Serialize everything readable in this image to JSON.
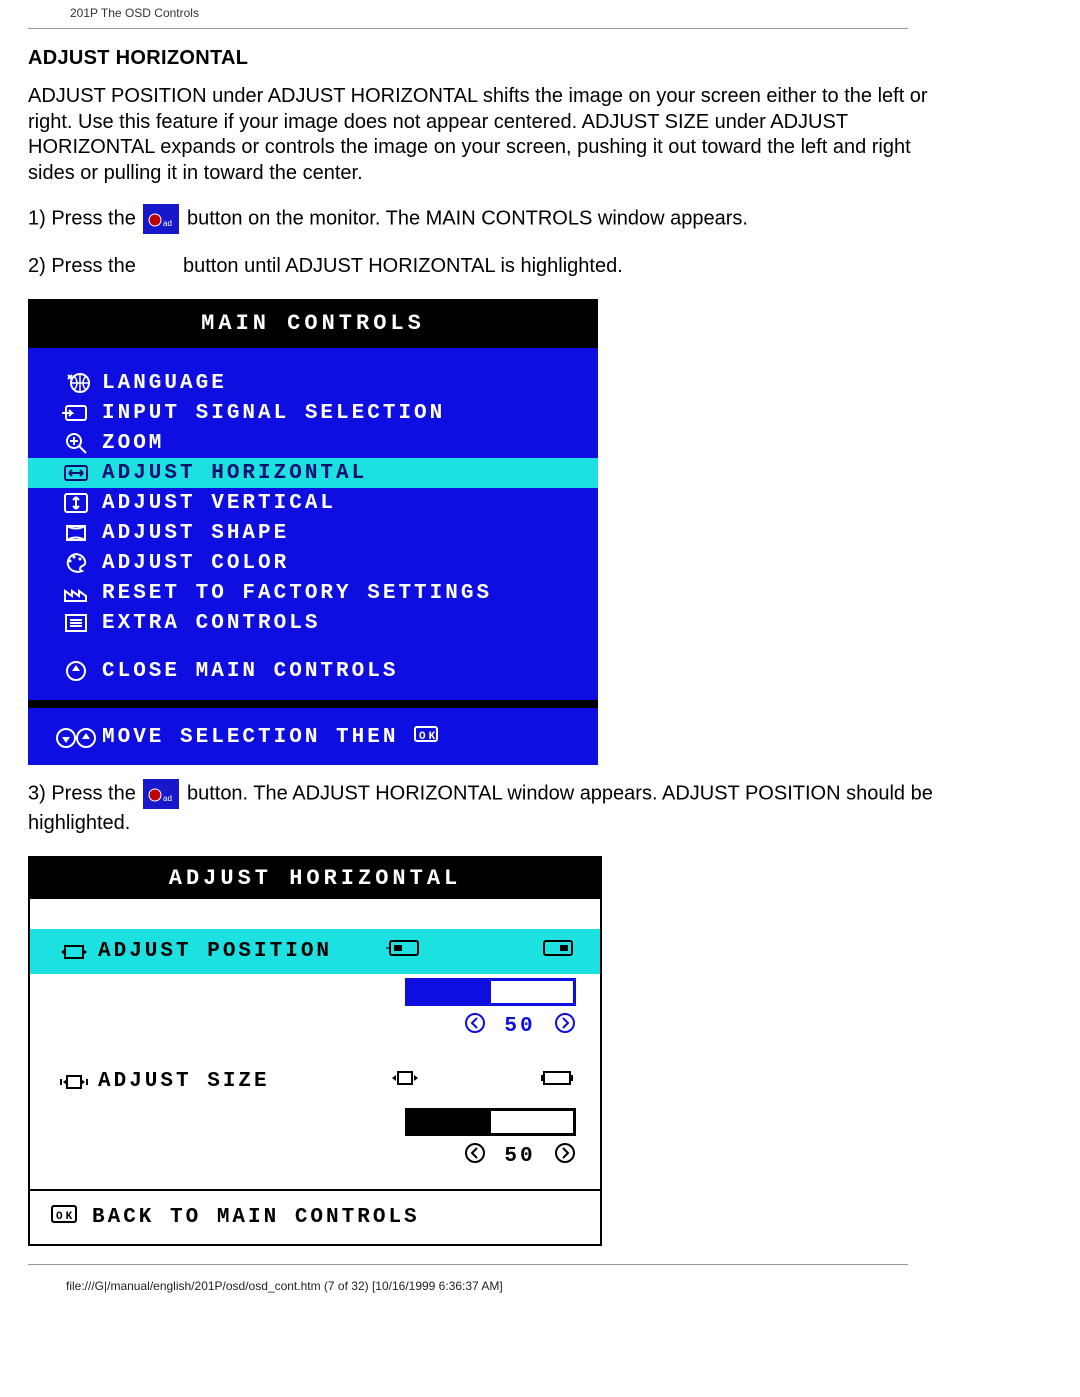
{
  "header": "201P The OSD Controls",
  "section_title": "ADJUST HORIZONTAL",
  "intro": "ADJUST POSITION under ADJUST HORIZONTAL shifts the image on your screen either to the left or right. Use this feature if your image does not appear centered. ADJUST SIZE under ADJUST HORIZONTAL expands or controls the image on your screen, pushing it out toward the left and right sides or pulling it in toward the center.",
  "step1_a": "1) Press the ",
  "step1_b": "button on the monitor. The MAIN CONTROLS window appears.",
  "step2_a": "2) Press the ",
  "step2_b": "button until ADJUST HORIZONTAL is highlighted.",
  "step3_a": "3) Press the ",
  "step3_b": "button. The ADJUST HORIZONTAL window appears. ADJUST POSITION should be highlighted.",
  "osd1": {
    "title": "MAIN CONTROLS",
    "items": [
      "LANGUAGE",
      "INPUT SIGNAL SELECTION",
      "ZOOM",
      "ADJUST HORIZONTAL",
      "ADJUST VERTICAL",
      "ADJUST SHAPE",
      "ADJUST COLOR",
      "RESET TO FACTORY SETTINGS",
      "EXTRA CONTROLS"
    ],
    "close": "CLOSE MAIN CONTROLS",
    "footer": "MOVE SELECTION THEN",
    "highlight_index": 3
  },
  "osd2": {
    "title": "ADJUST HORIZONTAL",
    "row_position": "ADJUST POSITION",
    "row_size": "ADJUST SIZE",
    "value_pos": "50",
    "value_size": "50",
    "footer": "BACK TO MAIN CONTROLS"
  },
  "footer_path": "file:///G|/manual/english/201P/osd/osd_cont.htm (7 of 32) [10/16/1999 6:36:37 AM]"
}
